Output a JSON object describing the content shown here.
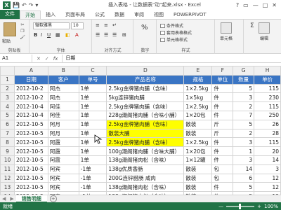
{
  "app": {
    "title": "插入表格 - 让数据表\"动\"起来.xlsx - Excel",
    "logo": "X",
    "qat": [
      "💾",
      "↶",
      "↷",
      "▾"
    ],
    "window_buttons": [
      "?",
      "▭",
      "—",
      "□",
      "✕"
    ]
  },
  "tabs": [
    "文件",
    "开始",
    "插入",
    "页面布局",
    "公式",
    "数据",
    "审阅",
    "视图",
    "POWERPIVOT"
  ],
  "active_tab": "开始",
  "ribbon": {
    "clipboard": {
      "paste": "粘贴",
      "label": "剪贴板"
    },
    "font": {
      "name": "微软雅黑",
      "size": "10",
      "bold": "B",
      "italic": "I",
      "underline": "U",
      "label": "字体"
    },
    "alignment": {
      "label": "对齐方式"
    },
    "number": {
      "format": "%",
      "label": "数字"
    },
    "styles": {
      "cond": "条件格式",
      "table": "套用表格格式",
      "cellstyle": "单元格样式",
      "label": "样式"
    },
    "cells": {
      "btn": "单元格",
      "label": ""
    },
    "editing": {
      "btn": "编辑",
      "label": ""
    }
  },
  "formula_bar": {
    "namebox": "A1",
    "fx": "fx",
    "value": "日期"
  },
  "columns": [
    "A",
    "B",
    "C",
    "D",
    "E",
    "F",
    "G",
    "H"
  ],
  "table": {
    "headers": [
      "日期",
      "客户",
      "单号",
      "产品名称",
      "规格",
      "单位",
      "数量",
      "单价"
    ],
    "rows": [
      [
        "2012-10-2",
        "阿杰",
        "1单",
        "2.5kg金牌猪肉脯（含味）",
        "1×2.5kg",
        "件",
        "5",
        "115"
      ],
      [
        "2012-10-2",
        "阿杰",
        "1单",
        "5kg连锌猪肉脯",
        "1×5kg",
        "件",
        "3",
        "230"
      ],
      [
        "2012-10-4",
        "阿佳",
        "1单",
        "2.5kg金牌猪肉脯（含味）",
        "1×2.5kg",
        "件",
        "2",
        "115"
      ],
      [
        "2012-10-4",
        "阿佳",
        "1单",
        "228g潮阁猪肉脯（合味小脯）",
        "1×20包",
        "件",
        "7",
        "250"
      ],
      [
        "2012-10-5",
        "阿月",
        "1单",
        "2.5kg金牌猪肉脯（含味）",
        "散装",
        "斤",
        "5",
        "26"
      ],
      [
        "2012-10-5",
        "阿月",
        "1单",
        "散装大脯",
        "散装",
        "斤",
        "2",
        "28"
      ],
      [
        "2012-10-5",
        "阿霞",
        "1单",
        "2.5kg金牌猪肉脯（含味）",
        "1×2.5kg",
        "件",
        "3",
        "115"
      ],
      [
        "2012-10-5",
        "阿霞",
        "1单",
        "100g潮阁猪肉脯（合味大脯）",
        "1×20包",
        "件",
        "1",
        "20"
      ],
      [
        "2012-10-5",
        "阿霞",
        "1单",
        "138g潮阁猪肉松（含味）",
        "1×12罐",
        "件",
        "3",
        "14"
      ],
      [
        "2012-10-5",
        "阿宾",
        "-1单",
        "138g优质香肠",
        "散装",
        "包",
        "14",
        "3"
      ],
      [
        "2012-10-5",
        "阿宾",
        "-1单",
        "200G连锌腊肠 咸肉",
        "散装",
        "包",
        "6",
        "12"
      ],
      [
        "2012-10-5",
        "阿宾",
        "-1单",
        "138g潮阁猪肉松（含味）",
        "散装",
        "件",
        "5",
        "12"
      ],
      [
        "2012-10-5",
        "阿宾",
        "-1单",
        "138g潮阁猪肉松（含味）",
        "散装",
        "件",
        "5",
        "12"
      ]
    ]
  },
  "sheet": {
    "name": "销售明细",
    "add": "+"
  },
  "status": {
    "mode": "就绪",
    "zoom": "100%",
    "minus": "—",
    "plus": "+"
  }
}
